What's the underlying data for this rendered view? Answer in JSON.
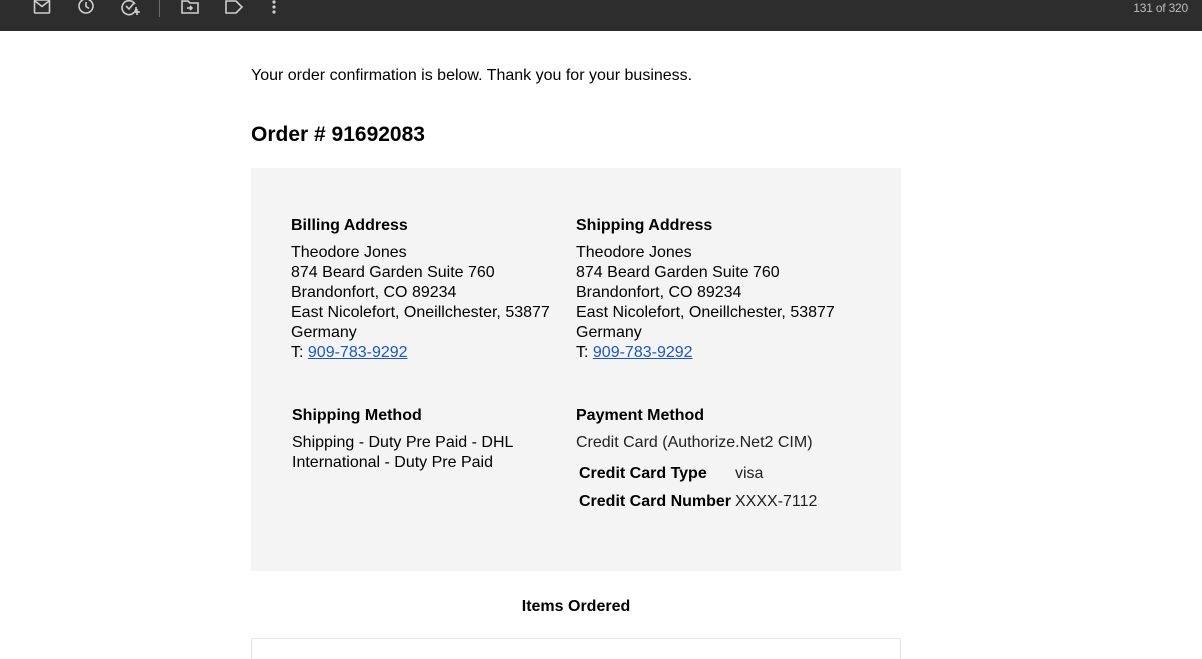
{
  "toolbar": {
    "icons": [
      "mark-unread-icon",
      "snooze-icon",
      "add-task-icon",
      "move-to-icon",
      "label-icon",
      "more-options-icon"
    ],
    "counter": "131 of 320"
  },
  "email": {
    "intro": "Your order confirmation is below. Thank you for your business.",
    "order_title": "Order # 91692083",
    "billing": {
      "title": "Billing Address",
      "name": "Theodore Jones",
      "street": "874 Beard Garden Suite 760",
      "city": "Brandonfort, CO 89234",
      "region": "East Nicolefort, Oneillchester, 53877",
      "country": "Germany",
      "phone_prefix": "T: ",
      "phone": "909-783-9292"
    },
    "shipping": {
      "title": "Shipping Address",
      "name": "Theodore Jones",
      "street": "874 Beard Garden Suite 760",
      "city": "Brandonfort, CO 89234",
      "region": "East Nicolefort, Oneillchester, 53877",
      "country": "Germany",
      "phone_prefix": "T: ",
      "phone": "909-783-9292"
    },
    "shipping_method": {
      "title": "Shipping Method",
      "line1": "Shipping - Duty Pre Paid - DHL",
      "line2": "International - Duty Pre Paid"
    },
    "payment_method": {
      "title": "Payment Method",
      "method": "Credit Card (Authorize.Net2 CIM)",
      "card_type_label": "Credit Card Type",
      "card_type_value": "visa",
      "card_number_label": "Credit Card Number",
      "card_number_value": "XXXX-7112"
    },
    "items_heading": "Items Ordered"
  },
  "colors": {
    "toolbar_bg": "#2d2d2d",
    "box_bg": "#f4f4f4",
    "link": "#1a57c4"
  }
}
